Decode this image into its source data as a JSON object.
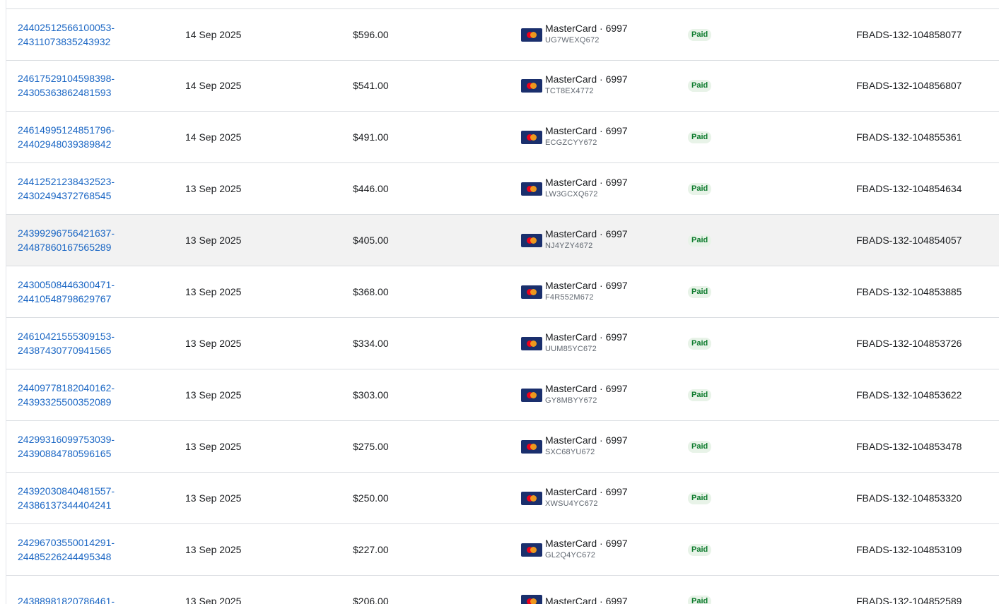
{
  "table": {
    "rows": [
      {
        "id_part1": "24402512566100053-",
        "id_part2": "24311073835243932",
        "date": "14 Sep 2025",
        "amount": "$596.00",
        "method": "MasterCard · 6997",
        "method_code": "UG7WEXQ672",
        "status": "Paid",
        "reference": "FBADS-132-104858077"
      },
      {
        "id_part1": "24617529104598398-",
        "id_part2": "24305363862481593",
        "date": "14 Sep 2025",
        "amount": "$541.00",
        "method": "MasterCard · 6997",
        "method_code": "TCT8EX4772",
        "status": "Paid",
        "reference": "FBADS-132-104856807"
      },
      {
        "id_part1": "24614995124851796-",
        "id_part2": "24402948039389842",
        "date": "14 Sep 2025",
        "amount": "$491.00",
        "method": "MasterCard · 6997",
        "method_code": "ECGZCYY672",
        "status": "Paid",
        "reference": "FBADS-132-104855361"
      },
      {
        "id_part1": "24412521238432523-",
        "id_part2": "24302494372768545",
        "date": "13 Sep 2025",
        "amount": "$446.00",
        "method": "MasterCard · 6997",
        "method_code": "LW3GCXQ672",
        "status": "Paid",
        "reference": "FBADS-132-104854634"
      },
      {
        "id_part1": "24399296756421637-",
        "id_part2": "24487860167565289",
        "date": "13 Sep 2025",
        "amount": "$405.00",
        "method": "MasterCard · 6997",
        "method_code": "NJ4YZY4672",
        "status": "Paid",
        "reference": "FBADS-132-104854057"
      },
      {
        "id_part1": "24300508446300471-",
        "id_part2": "24410548798629767",
        "date": "13 Sep 2025",
        "amount": "$368.00",
        "method": "MasterCard · 6997",
        "method_code": "F4R552M672",
        "status": "Paid",
        "reference": "FBADS-132-104853885"
      },
      {
        "id_part1": "24610421555309153-",
        "id_part2": "24387430770941565",
        "date": "13 Sep 2025",
        "amount": "$334.00",
        "method": "MasterCard · 6997",
        "method_code": "UUM85YC672",
        "status": "Paid",
        "reference": "FBADS-132-104853726"
      },
      {
        "id_part1": "24409778182040162-",
        "id_part2": "24393325500352089",
        "date": "13 Sep 2025",
        "amount": "$303.00",
        "method": "MasterCard · 6997",
        "method_code": "GY8MBYY672",
        "status": "Paid",
        "reference": "FBADS-132-104853622"
      },
      {
        "id_part1": "24299316099753039-",
        "id_part2": "24390884780596165",
        "date": "13 Sep 2025",
        "amount": "$275.00",
        "method": "MasterCard · 6997",
        "method_code": "SXC68YU672",
        "status": "Paid",
        "reference": "FBADS-132-104853478"
      },
      {
        "id_part1": "24392030840481557-",
        "id_part2": "24386137344404241",
        "date": "13 Sep 2025",
        "amount": "$250.00",
        "method": "MasterCard · 6997",
        "method_code": "XWSU4YC672",
        "status": "Paid",
        "reference": "FBADS-132-104853320"
      },
      {
        "id_part1": "24296703550014291-",
        "id_part2": "24485226244495348",
        "date": "13 Sep 2025",
        "amount": "$227.00",
        "method": "MasterCard · 6997",
        "method_code": "GL2Q4YC672",
        "status": "Paid",
        "reference": "FBADS-132-104853109"
      },
      {
        "id_part1": "24388981820786461-",
        "id_part2": "",
        "date": "13 Sep 2025",
        "amount": "$206.00",
        "method": "MasterCard · 6997",
        "method_code": "",
        "status": "Paid",
        "reference": "FBADS-132-104852589"
      }
    ]
  },
  "colors": {
    "link": "#1a66c4",
    "paid_badge_bg": "#e8f3e8",
    "paid_badge_text": "#0c7a2c",
    "row_hover": "#f2f2f2",
    "card_bg": "#1a2f6d"
  },
  "icons": {
    "payment_method": "mastercard-icon"
  }
}
